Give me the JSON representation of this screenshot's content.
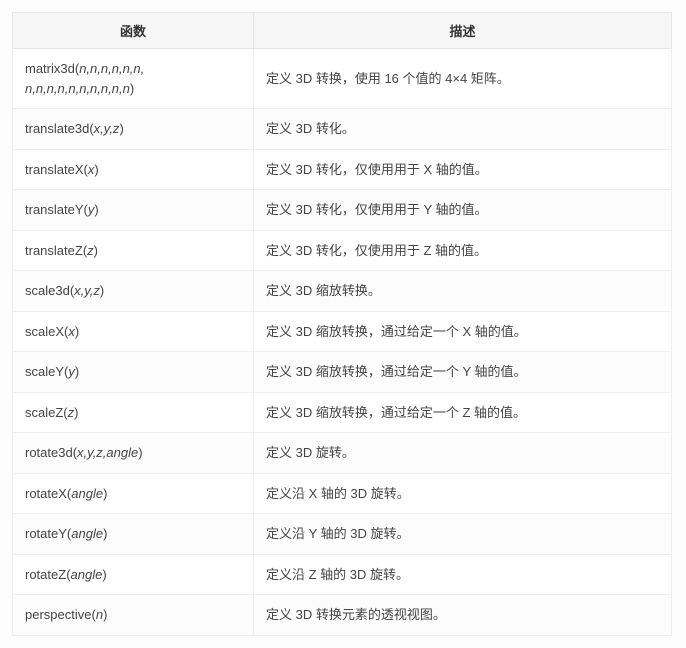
{
  "table": {
    "headers": {
      "func": "函数",
      "desc": "描述"
    },
    "rows": [
      {
        "func_name": "matrix3d",
        "func_params": "n,n,n,n,n,n, n,n,n,n,n,n,n,n,n,n",
        "desc": "定义 3D 转换，使用 16 个值的 4×4 矩阵。"
      },
      {
        "func_name": "translate3d",
        "func_params": "x,y,z",
        "desc": "定义 3D 转化。"
      },
      {
        "func_name": "translateX",
        "func_params": "x",
        "desc": "定义 3D 转化，仅使用用于 X 轴的值。"
      },
      {
        "func_name": "translateY",
        "func_params": "y",
        "desc": "定义 3D 转化，仅使用用于 Y 轴的值。"
      },
      {
        "func_name": "translateZ",
        "func_params": "z",
        "desc": "定义 3D 转化，仅使用用于 Z 轴的值。"
      },
      {
        "func_name": "scale3d",
        "func_params": "x,y,z",
        "desc": "定义 3D 缩放转换。"
      },
      {
        "func_name": "scaleX",
        "func_params": "x",
        "desc": "定义 3D 缩放转换，通过给定一个 X 轴的值。"
      },
      {
        "func_name": "scaleY",
        "func_params": "y",
        "desc": "定义 3D 缩放转换，通过给定一个 Y 轴的值。"
      },
      {
        "func_name": "scaleZ",
        "func_params": "z",
        "desc": "定义 3D 缩放转换，通过给定一个 Z 轴的值。"
      },
      {
        "func_name": "rotate3d",
        "func_params": "x,y,z,angle",
        "desc": "定义 3D 旋转。"
      },
      {
        "func_name": "rotateX",
        "func_params": "angle",
        "desc": "定义沿 X 轴的 3D 旋转。"
      },
      {
        "func_name": "rotateY",
        "func_params": "angle",
        "desc": "定义沿 Y 轴的 3D 旋转。"
      },
      {
        "func_name": "rotateZ",
        "func_params": "angle",
        "desc": "定义沿 Z 轴的 3D 旋转。"
      },
      {
        "func_name": "perspective",
        "func_params": "n",
        "desc": "定义 3D 转换元素的透视视图。"
      }
    ]
  }
}
